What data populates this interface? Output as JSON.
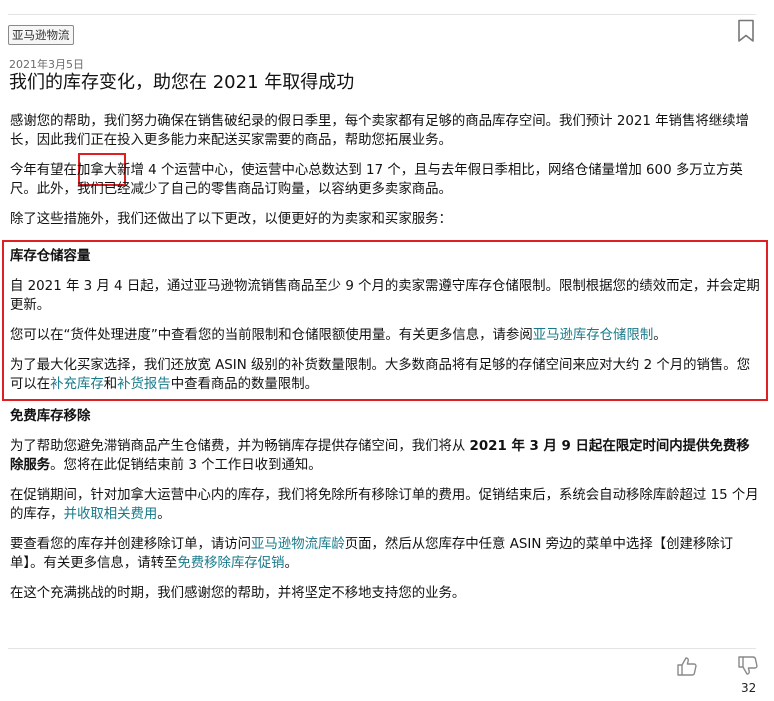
{
  "article": {
    "tag": "亚马逊物流",
    "date": "2021年3月5日",
    "title": "我们的库存变化，助您在 2021 年取得成功",
    "p1": "感谢您的帮助，我们努力确保在销售破纪录的假日季里，每个卖家都有足够的商品库存空间。我们预计 2021 年销售将继续增长，因此我们正在投入更多能力来配送买家需要的商品，帮助您拓展业务。",
    "p2_a": "今年有望在",
    "p2_hl": "加拿大",
    "p2_b": "新增 4 个运营中心，使运营中心总数达到 17 个，且与去年假日季相比，网络仓储量增加 600 多万立方英尺。此外，我们已经减少了自己的零售商品订购量，以容纳更多卖家商品。",
    "p3": "除了这些措施外，我们还做出了以下更改，以便更好的为卖家和买家服务：",
    "section1": {
      "heading": "库存仓储容量",
      "p1": "自 2021 年 3 月 4 日起，通过亚马逊物流销售商品至少 9 个月的卖家需遵守库存仓储限制。限制根据您的绩效而定，并会定期更新。",
      "p2_a": "您可以在“货件处理进度”中查看您的当前限制和仓储限额使用量。有关更多信息，请参阅",
      "p2_link": "亚马逊库存仓储限制",
      "p2_b": "。",
      "p3_a": "为了最大化买家选择，我们还放宽 ASIN 级别的补货数量限制。大多数商品将有足够的存储空间来应对大约 2 个月的销售。您可以在",
      "p3_link1": "补充库存",
      "p3_mid": "和",
      "p3_link2": "补货报告",
      "p3_b": "中查看商品的数量限制。"
    },
    "section2": {
      "heading": "免费库存移除",
      "p1_a": "为了帮助您避免滞销商品产生仓储费，并为畅销库存提供存储空间，我们将从 ",
      "p1_bold": "2021 年 3 月 9 日起在限定时间内提供免费移除服务",
      "p1_b": "。您将在此促销结束前 3 个工作日收到通知。",
      "p2_a": "在促销期间，针对加拿大运营中心内的库存，我们将免除所有移除订单的费用。促销结束后，系统会自动移除库龄超过 15 个月的库存，",
      "p2_link": "并收取相关费用",
      "p2_b": "。",
      "p3_a": "要查看您的库存并创建移除订单，请访问",
      "p3_link1": "亚马逊物流库龄",
      "p3_mid": "页面，然后从您库存中任意 ASIN 旁边的菜单中选择【创建移除订单】。有关更多信息，请转至",
      "p3_link2": "免费移除库存促销",
      "p3_b": "。",
      "p4": "在这个充满挑战的时期，我们感谢您的帮助，并将坚定不移地支持您的业务。"
    }
  },
  "footer": {
    "like_icon": "thumbs-up-icon",
    "dislike_icon": "thumbs-down-icon",
    "count": "32"
  },
  "colors": {
    "link": "#197a8a",
    "highlight_border": "#e02020",
    "text": "#111111"
  }
}
